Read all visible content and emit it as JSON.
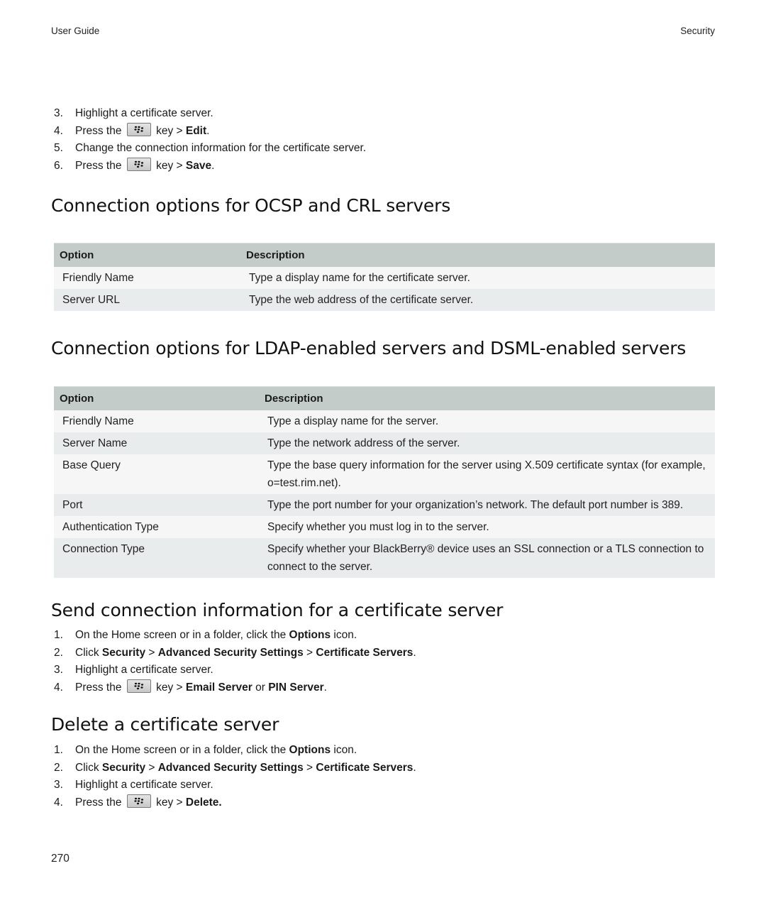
{
  "header": {
    "left": "User Guide",
    "right": "Security"
  },
  "key_icon": "blackberry-menu-key-icon",
  "intro_steps": [
    {
      "num": "3.",
      "parts": [
        {
          "t": "Highlight a certificate server."
        }
      ]
    },
    {
      "num": "4.",
      "parts": [
        {
          "t": "Press the "
        },
        {
          "key": true
        },
        {
          "t": " key > "
        },
        {
          "t": "Edit",
          "b": true
        },
        {
          "t": "."
        }
      ]
    },
    {
      "num": "5.",
      "parts": [
        {
          "t": "Change the connection information for the certificate server."
        }
      ]
    },
    {
      "num": "6.",
      "parts": [
        {
          "t": "Press the "
        },
        {
          "key": true
        },
        {
          "t": " key > "
        },
        {
          "t": "Save",
          "b": true
        },
        {
          "t": "."
        }
      ]
    }
  ],
  "ocsp": {
    "heading": "Connection options for OCSP and CRL servers",
    "columns": [
      "Option",
      "Description"
    ],
    "rows": [
      [
        "Friendly Name",
        "Type a display name for the certificate server."
      ],
      [
        "Server URL",
        "Type the web address of the certificate server."
      ]
    ]
  },
  "ldap": {
    "heading": "Connection options for LDAP-enabled servers and DSML-enabled servers",
    "columns": [
      "Option",
      "Description"
    ],
    "rows": [
      [
        "Friendly Name",
        "Type a display name for the server."
      ],
      [
        "Server Name",
        "Type the network address of the server."
      ],
      [
        "Base Query",
        "Type the base query information for the server using X.509 certificate syntax (for example, o=test.rim.net)."
      ],
      [
        "Port",
        "Type the port number for your organization’s network. The default port number is 389."
      ],
      [
        "Authentication Type",
        "Specify whether you must log in to the server."
      ],
      [
        "Connection Type",
        "Specify whether your BlackBerry® device uses an SSL connection or a TLS connection to connect to the server."
      ]
    ]
  },
  "send": {
    "heading": "Send connection information for a certificate server",
    "steps": [
      {
        "num": "1.",
        "parts": [
          {
            "t": "On the Home screen or in a folder, click the "
          },
          {
            "t": "Options",
            "b": true
          },
          {
            "t": " icon."
          }
        ]
      },
      {
        "num": "2.",
        "parts": [
          {
            "t": "Click "
          },
          {
            "t": "Security",
            "b": true
          },
          {
            "t": " > "
          },
          {
            "t": "Advanced Security Settings",
            "b": true
          },
          {
            "t": " > "
          },
          {
            "t": "Certificate Servers",
            "b": true
          },
          {
            "t": "."
          }
        ]
      },
      {
        "num": "3.",
        "parts": [
          {
            "t": "Highlight a certificate server."
          }
        ]
      },
      {
        "num": "4.",
        "parts": [
          {
            "t": "Press the "
          },
          {
            "key": true
          },
          {
            "t": " key > "
          },
          {
            "t": "Email Server",
            "b": true
          },
          {
            "t": " or "
          },
          {
            "t": "PIN Server",
            "b": true
          },
          {
            "t": "."
          }
        ]
      }
    ]
  },
  "delete": {
    "heading": "Delete a certificate server",
    "steps": [
      {
        "num": "1.",
        "parts": [
          {
            "t": "On the Home screen or in a folder, click the "
          },
          {
            "t": "Options",
            "b": true
          },
          {
            "t": " icon."
          }
        ]
      },
      {
        "num": "2.",
        "parts": [
          {
            "t": "Click "
          },
          {
            "t": "Security",
            "b": true
          },
          {
            "t": " > "
          },
          {
            "t": "Advanced Security Settings",
            "b": true
          },
          {
            "t": " > "
          },
          {
            "t": "Certificate Servers",
            "b": true
          },
          {
            "t": "."
          }
        ]
      },
      {
        "num": "3.",
        "parts": [
          {
            "t": "Highlight a certificate server."
          }
        ]
      },
      {
        "num": "4.",
        "parts": [
          {
            "t": "Press the "
          },
          {
            "key": true
          },
          {
            "t": " key > "
          },
          {
            "t": "Delete.",
            "b": true
          }
        ]
      }
    ]
  },
  "footer": {
    "page_number": "270"
  }
}
